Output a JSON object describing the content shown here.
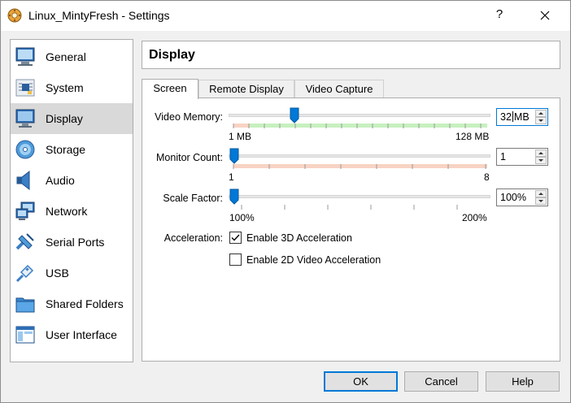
{
  "window": {
    "title": "Linux_MintyFresh - Settings",
    "help_symbol": "?"
  },
  "colors": {
    "accent": "#0078d7",
    "selected_bg": "#d9d9d9",
    "range_good": "#c7f0bf",
    "range_bad": "#f8d3c3"
  },
  "sidebar": {
    "items": [
      {
        "label": "General",
        "icon": "general-monitor-icon"
      },
      {
        "label": "System",
        "icon": "chip-icon"
      },
      {
        "label": "Display",
        "icon": "display-monitor-icon",
        "selected": true
      },
      {
        "label": "Storage",
        "icon": "disc-icon"
      },
      {
        "label": "Audio",
        "icon": "speaker-icon"
      },
      {
        "label": "Network",
        "icon": "network-icon"
      },
      {
        "label": "Serial Ports",
        "icon": "serial-cable-icon"
      },
      {
        "label": "USB",
        "icon": "usb-plug-icon"
      },
      {
        "label": "Shared Folders",
        "icon": "folder-icon"
      },
      {
        "label": "User Interface",
        "icon": "window-ui-icon"
      }
    ]
  },
  "page": {
    "title": "Display"
  },
  "tabs": [
    {
      "label": "Screen",
      "active": true
    },
    {
      "label": "Remote Display"
    },
    {
      "label": "Video Capture"
    }
  ],
  "screen": {
    "video_memory": {
      "label": "Video Memory:",
      "value": "32",
      "unit": "MB",
      "min_label": "1 MB",
      "max_label": "128 MB",
      "min": 1,
      "max": 128,
      "current": 32
    },
    "monitor_count": {
      "label": "Monitor Count:",
      "value": "1",
      "min_label": "1",
      "max_label": "8",
      "min": 1,
      "max": 8,
      "current": 1
    },
    "scale_factor": {
      "label": "Scale Factor:",
      "value": "100%",
      "min_label": "100%",
      "max_label": "200%",
      "min": 100,
      "max": 200,
      "current": 100
    },
    "acceleration": {
      "label": "Acceleration:",
      "enable_3d": {
        "label": "Enable 3D Acceleration",
        "checked": true
      },
      "enable_2d": {
        "label": "Enable 2D Video Acceleration",
        "checked": false
      }
    }
  },
  "buttons": {
    "ok": "OK",
    "cancel": "Cancel",
    "help": "Help"
  }
}
